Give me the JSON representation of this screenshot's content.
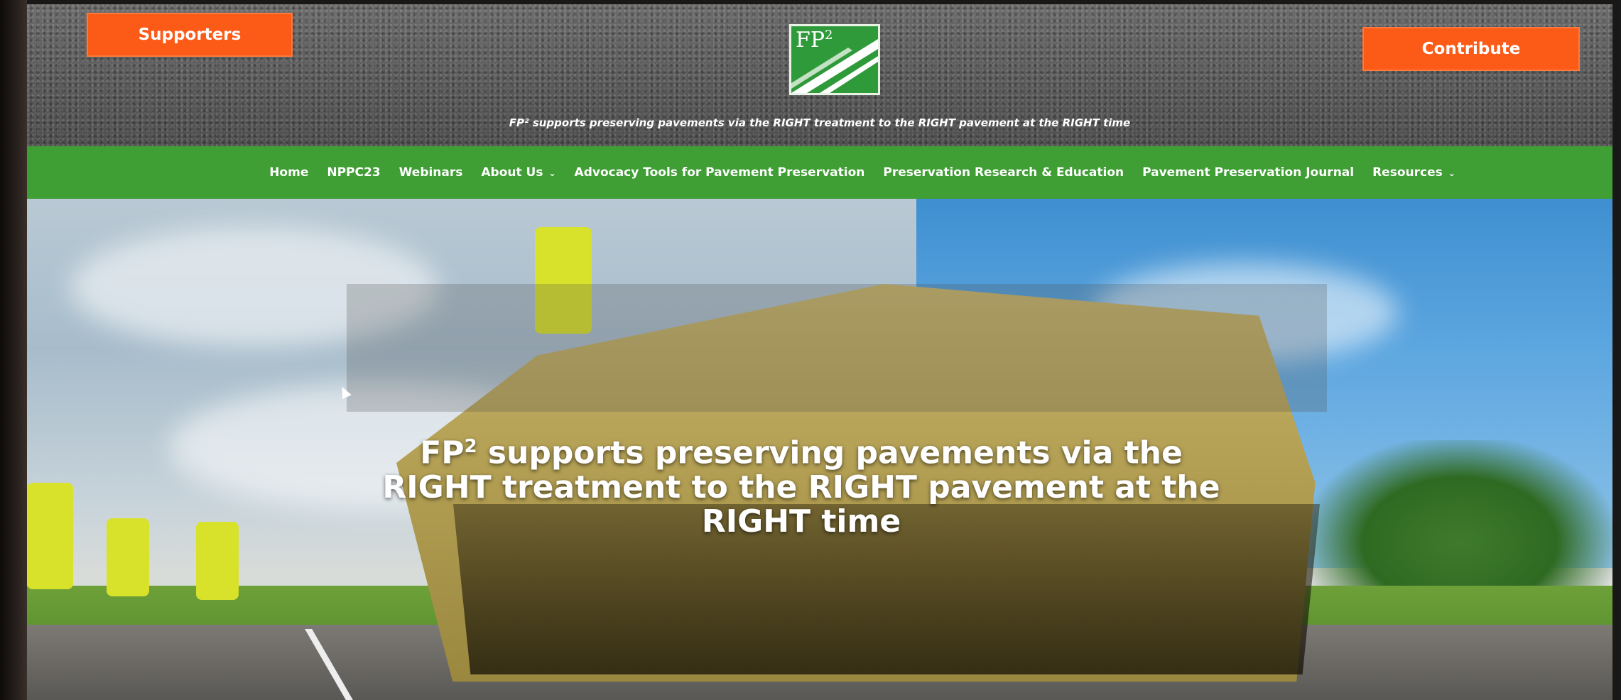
{
  "header": {
    "supporters_label": "Supporters",
    "contribute_label": "Contribute",
    "logo": {
      "text": "FP",
      "sup": "2"
    },
    "tagline": "FP² supports preserving pavements via the RIGHT treatment to the RIGHT pavement at the RIGHT time"
  },
  "nav": {
    "items": [
      {
        "label": "Home",
        "dropdown": false
      },
      {
        "label": "NPPC23",
        "dropdown": false
      },
      {
        "label": "Webinars",
        "dropdown": false
      },
      {
        "label": "About Us",
        "dropdown": true
      },
      {
        "label": "Advocacy Tools for Pavement Preservation",
        "dropdown": false
      },
      {
        "label": "Preservation Research & Education",
        "dropdown": false
      },
      {
        "label": "Pavement Preservation Journal",
        "dropdown": false
      },
      {
        "label": "Resources",
        "dropdown": true
      }
    ]
  },
  "hero": {
    "title_line1_a": "FP",
    "title_line1_sup": "2",
    "title_line1_b": " supports preserving pavements via the",
    "title_line2": "RIGHT treatment to the RIGHT pavement at the",
    "title_line3": "RIGHT time"
  },
  "colors": {
    "accent_orange": "#fb5a17",
    "nav_green": "#3f9e34",
    "logo_green": "#2f9a3a"
  }
}
